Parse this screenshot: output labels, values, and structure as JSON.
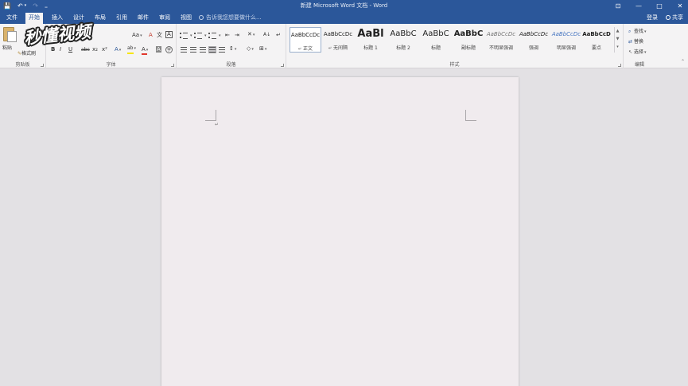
{
  "window": {
    "title": "新建 Microsoft Word 文档 - Word",
    "qat": {
      "save_icon": "💾",
      "undo_icon": "↶",
      "undo_dropdown": "▾",
      "redo_icon": "↷",
      "customize": "₌"
    },
    "controls": {
      "help": "?",
      "restore_ribbon": "⊡",
      "minimize": "—",
      "maximize": "□",
      "close": "✕"
    }
  },
  "tabs": [
    {
      "label": "文件"
    },
    {
      "label": "开始",
      "active": true
    },
    {
      "label": "插入"
    },
    {
      "label": "设计"
    },
    {
      "label": "布局"
    },
    {
      "label": "引用"
    },
    {
      "label": "邮件"
    },
    {
      "label": "审阅"
    },
    {
      "label": "视图"
    }
  ],
  "tell_me": {
    "text": "告诉我您想要做什么..."
  },
  "account": {
    "sign_in": "登录",
    "share": "共享"
  },
  "logo": {
    "text": "秒懂视频"
  },
  "clipboard": {
    "group_label": "剪贴板",
    "paste": "粘贴",
    "format_painter": "格式刷"
  },
  "font": {
    "group_label": "字体",
    "change_case": "Aa",
    "clear_format": "A",
    "phonetic": "文",
    "border_char": "A",
    "bold": "B",
    "italic": "I",
    "underline": "U",
    "strikethrough": "abc",
    "subscript": "x₂",
    "superscript": "x²",
    "text_effect": "A",
    "highlight": "ab",
    "font_color": "A",
    "shading": "A",
    "enclose": "字"
  },
  "paragraph": {
    "group_label": "段落",
    "sort": "A↓",
    "show_marks": "↵"
  },
  "styles": {
    "group_label": "样式",
    "items": [
      {
        "sample": "AaBbCcDc",
        "name": "正文",
        "prefix": "↵",
        "active": true
      },
      {
        "sample": "AaBbCcDc",
        "name": "无间隔",
        "prefix": "↵"
      },
      {
        "sample": "AaBl",
        "name": "标题 1"
      },
      {
        "sample": "AaBbC",
        "name": "标题 2"
      },
      {
        "sample": "AaBbC",
        "name": "标题"
      },
      {
        "sample": "AaBbC",
        "name": "副标题"
      },
      {
        "sample": "AaBbCcDc",
        "name": "不明显强调"
      },
      {
        "sample": "AaBbCcDc",
        "name": "强调"
      },
      {
        "sample": "AaBbCcDc",
        "name": "明显强调"
      },
      {
        "sample": "AaBbCcD",
        "name": "要点"
      }
    ]
  },
  "editing": {
    "group_label": "编辑",
    "find": "查找",
    "replace": "替换",
    "select": "选择"
  },
  "document": {
    "paragraph_mark": "↵"
  },
  "colors": {
    "brand": "#2b579a",
    "ribbon": "#f4f3f4",
    "workspace": "#e3e1e4",
    "page": "#f0ebee",
    "highlight_yellow": "#f7e500",
    "font_red": "#e0382e"
  }
}
